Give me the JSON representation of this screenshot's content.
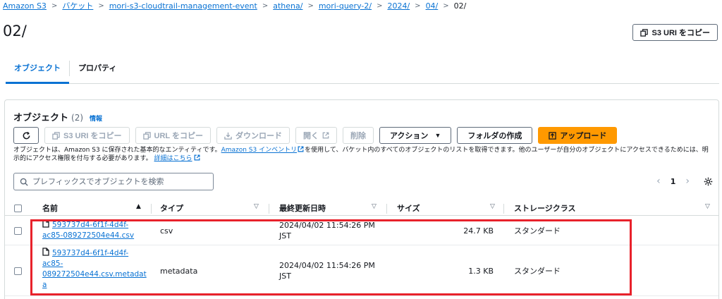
{
  "breadcrumb": {
    "items": [
      "Amazon S3",
      "バケット",
      "mori-s3-cloudtrail-management-event",
      "athena/",
      "mori-query-2/",
      "2024/",
      "04/"
    ],
    "current": "02/"
  },
  "page": {
    "title": "02/",
    "copy_uri_label": "S3 URI をコピー"
  },
  "tabs": [
    "オブジェクト",
    "プロパティ"
  ],
  "panel": {
    "heading": "オブジェクト",
    "count": "(2)",
    "info": "情報",
    "toolbar": {
      "copy_s3_uri": "S3 URI をコピー",
      "copy_url": "URL をコピー",
      "download": "ダウンロード",
      "open": "開く",
      "delete": "削除",
      "actions": "アクション",
      "create_folder": "フォルダの作成",
      "upload": "アップロード"
    },
    "description": {
      "part1": "オブジェクトは、Amazon S3 に保存された基本的なエンティティです。",
      "link1": "Amazon S3 インベントリ",
      "part2": "を使用して、バケット内のすべてのオブジェクトのリストを取得できます。他のユーザーが自分のオブジェクトにアクセスできるためには、明示的にアクセス権限を付与する必要があります。",
      "link2": "詳細はこちら"
    },
    "search_placeholder": "プレフィックスでオブジェクトを検索",
    "page_number": "1"
  },
  "table": {
    "headers": {
      "name": "名前",
      "type": "タイプ",
      "modified": "最終更新日時",
      "size": "サイズ",
      "storage_class": "ストレージクラス"
    },
    "rows": [
      {
        "name_lines": [
          "593737d4-6f1f-4d4f-",
          "ac85-089272504e44.csv"
        ],
        "type": "csv",
        "modified_date": "2024/04/02 11:54:26 PM",
        "modified_tz": "JST",
        "size": "24.7 KB",
        "storage_class": "スタンダード"
      },
      {
        "name_lines": [
          "593737d4-6f1f-4d4f-",
          "ac85-",
          "089272504e44.csv.metadat",
          "a"
        ],
        "type": "metadata",
        "modified_date": "2024/04/02 11:54:26 PM",
        "modified_tz": "JST",
        "size": "1.3 KB",
        "storage_class": "スタンダード"
      }
    ]
  },
  "colors": {
    "link": "#0972d3",
    "primary": "#ff9900",
    "highlight": "#e8212b"
  }
}
